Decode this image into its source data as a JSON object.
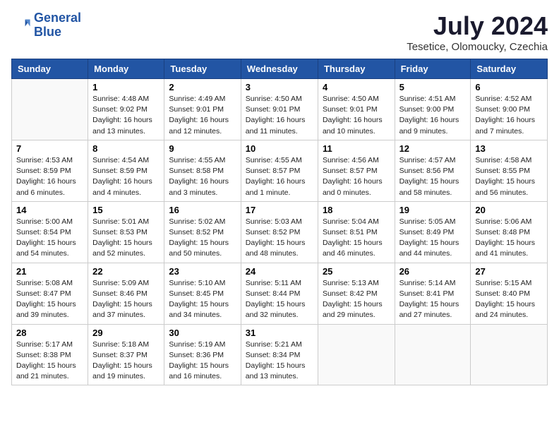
{
  "logo": {
    "line1": "General",
    "line2": "Blue"
  },
  "title": "July 2024",
  "location": "Tesetice, Olomoucky, Czechia",
  "weekdays": [
    "Sunday",
    "Monday",
    "Tuesday",
    "Wednesday",
    "Thursday",
    "Friday",
    "Saturday"
  ],
  "weeks": [
    [
      {
        "day": "",
        "info": ""
      },
      {
        "day": "1",
        "info": "Sunrise: 4:48 AM\nSunset: 9:02 PM\nDaylight: 16 hours\nand 13 minutes."
      },
      {
        "day": "2",
        "info": "Sunrise: 4:49 AM\nSunset: 9:01 PM\nDaylight: 16 hours\nand 12 minutes."
      },
      {
        "day": "3",
        "info": "Sunrise: 4:50 AM\nSunset: 9:01 PM\nDaylight: 16 hours\nand 11 minutes."
      },
      {
        "day": "4",
        "info": "Sunrise: 4:50 AM\nSunset: 9:01 PM\nDaylight: 16 hours\nand 10 minutes."
      },
      {
        "day": "5",
        "info": "Sunrise: 4:51 AM\nSunset: 9:00 PM\nDaylight: 16 hours\nand 9 minutes."
      },
      {
        "day": "6",
        "info": "Sunrise: 4:52 AM\nSunset: 9:00 PM\nDaylight: 16 hours\nand 7 minutes."
      }
    ],
    [
      {
        "day": "7",
        "info": "Sunrise: 4:53 AM\nSunset: 8:59 PM\nDaylight: 16 hours\nand 6 minutes."
      },
      {
        "day": "8",
        "info": "Sunrise: 4:54 AM\nSunset: 8:59 PM\nDaylight: 16 hours\nand 4 minutes."
      },
      {
        "day": "9",
        "info": "Sunrise: 4:55 AM\nSunset: 8:58 PM\nDaylight: 16 hours\nand 3 minutes."
      },
      {
        "day": "10",
        "info": "Sunrise: 4:55 AM\nSunset: 8:57 PM\nDaylight: 16 hours\nand 1 minute."
      },
      {
        "day": "11",
        "info": "Sunrise: 4:56 AM\nSunset: 8:57 PM\nDaylight: 16 hours\nand 0 minutes."
      },
      {
        "day": "12",
        "info": "Sunrise: 4:57 AM\nSunset: 8:56 PM\nDaylight: 15 hours\nand 58 minutes."
      },
      {
        "day": "13",
        "info": "Sunrise: 4:58 AM\nSunset: 8:55 PM\nDaylight: 15 hours\nand 56 minutes."
      }
    ],
    [
      {
        "day": "14",
        "info": "Sunrise: 5:00 AM\nSunset: 8:54 PM\nDaylight: 15 hours\nand 54 minutes."
      },
      {
        "day": "15",
        "info": "Sunrise: 5:01 AM\nSunset: 8:53 PM\nDaylight: 15 hours\nand 52 minutes."
      },
      {
        "day": "16",
        "info": "Sunrise: 5:02 AM\nSunset: 8:52 PM\nDaylight: 15 hours\nand 50 minutes."
      },
      {
        "day": "17",
        "info": "Sunrise: 5:03 AM\nSunset: 8:52 PM\nDaylight: 15 hours\nand 48 minutes."
      },
      {
        "day": "18",
        "info": "Sunrise: 5:04 AM\nSunset: 8:51 PM\nDaylight: 15 hours\nand 46 minutes."
      },
      {
        "day": "19",
        "info": "Sunrise: 5:05 AM\nSunset: 8:49 PM\nDaylight: 15 hours\nand 44 minutes."
      },
      {
        "day": "20",
        "info": "Sunrise: 5:06 AM\nSunset: 8:48 PM\nDaylight: 15 hours\nand 41 minutes."
      }
    ],
    [
      {
        "day": "21",
        "info": "Sunrise: 5:08 AM\nSunset: 8:47 PM\nDaylight: 15 hours\nand 39 minutes."
      },
      {
        "day": "22",
        "info": "Sunrise: 5:09 AM\nSunset: 8:46 PM\nDaylight: 15 hours\nand 37 minutes."
      },
      {
        "day": "23",
        "info": "Sunrise: 5:10 AM\nSunset: 8:45 PM\nDaylight: 15 hours\nand 34 minutes."
      },
      {
        "day": "24",
        "info": "Sunrise: 5:11 AM\nSunset: 8:44 PM\nDaylight: 15 hours\nand 32 minutes."
      },
      {
        "day": "25",
        "info": "Sunrise: 5:13 AM\nSunset: 8:42 PM\nDaylight: 15 hours\nand 29 minutes."
      },
      {
        "day": "26",
        "info": "Sunrise: 5:14 AM\nSunset: 8:41 PM\nDaylight: 15 hours\nand 27 minutes."
      },
      {
        "day": "27",
        "info": "Sunrise: 5:15 AM\nSunset: 8:40 PM\nDaylight: 15 hours\nand 24 minutes."
      }
    ],
    [
      {
        "day": "28",
        "info": "Sunrise: 5:17 AM\nSunset: 8:38 PM\nDaylight: 15 hours\nand 21 minutes."
      },
      {
        "day": "29",
        "info": "Sunrise: 5:18 AM\nSunset: 8:37 PM\nDaylight: 15 hours\nand 19 minutes."
      },
      {
        "day": "30",
        "info": "Sunrise: 5:19 AM\nSunset: 8:36 PM\nDaylight: 15 hours\nand 16 minutes."
      },
      {
        "day": "31",
        "info": "Sunrise: 5:21 AM\nSunset: 8:34 PM\nDaylight: 15 hours\nand 13 minutes."
      },
      {
        "day": "",
        "info": ""
      },
      {
        "day": "",
        "info": ""
      },
      {
        "day": "",
        "info": ""
      }
    ]
  ]
}
